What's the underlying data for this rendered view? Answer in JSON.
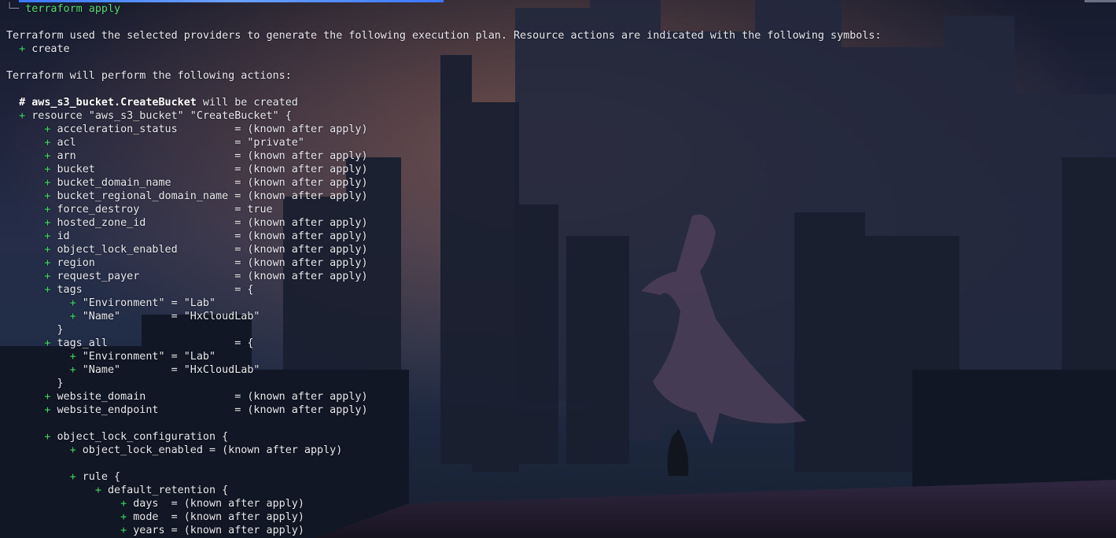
{
  "prompt": {
    "branch_symbol": "└─",
    "command": "terraform apply"
  },
  "intro": "Terraform used the selected providers to generate the following execution plan. Resource actions are indicated with the following symbols:",
  "legend_create": "create",
  "perform": "Terraform will perform the following actions:",
  "resource_comment_name": "aws_s3_bucket.CreateBucket",
  "resource_comment_suffix": " will be created",
  "resource_open": "resource \"aws_s3_bucket\" \"CreateBucket\" {",
  "attributes": [
    {
      "key": "acceleration_status         ",
      "value": "= (known after apply)"
    },
    {
      "key": "acl                         ",
      "value": "= \"private\""
    },
    {
      "key": "arn                         ",
      "value": "= (known after apply)"
    },
    {
      "key": "bucket                      ",
      "value": "= (known after apply)"
    },
    {
      "key": "bucket_domain_name          ",
      "value": "= (known after apply)"
    },
    {
      "key": "bucket_regional_domain_name ",
      "value": "= (known after apply)"
    },
    {
      "key": "force_destroy               ",
      "value": "= true"
    },
    {
      "key": "hosted_zone_id              ",
      "value": "= (known after apply)"
    },
    {
      "key": "id                          ",
      "value": "= (known after apply)"
    },
    {
      "key": "object_lock_enabled         ",
      "value": "= (known after apply)"
    },
    {
      "key": "region                      ",
      "value": "= (known after apply)"
    },
    {
      "key": "request_payer               ",
      "value": "= (known after apply)"
    }
  ],
  "tags": {
    "key": "tags                        ",
    "open": "= {",
    "items": [
      {
        "key": "\"Environment\"",
        "value": " = \"Lab\""
      },
      {
        "key": "\"Name\"       ",
        "value": " = \"HxCloudLab\""
      }
    ],
    "close": "}"
  },
  "tags_all": {
    "key": "tags_all                    ",
    "open": "= {",
    "items": [
      {
        "key": "\"Environment\"",
        "value": " = \"Lab\""
      },
      {
        "key": "\"Name\"       ",
        "value": " = \"HxCloudLab\""
      }
    ],
    "close": "}"
  },
  "website": [
    {
      "key": "website_domain              ",
      "value": "= (known after apply)"
    },
    {
      "key": "website_endpoint            ",
      "value": "= (known after apply)"
    }
  ],
  "olc": {
    "open": "object_lock_configuration {",
    "enabled": "object_lock_enabled = (known after apply)",
    "rule_open": "rule {",
    "retention_open": "default_retention {",
    "retention": [
      "days  = (known after apply)",
      "mode  = (known after apply)",
      "years = (known after apply)"
    ]
  },
  "colors": {
    "plus": "#3fd96a",
    "command": "#57d870",
    "text": "#e9e9ee"
  }
}
